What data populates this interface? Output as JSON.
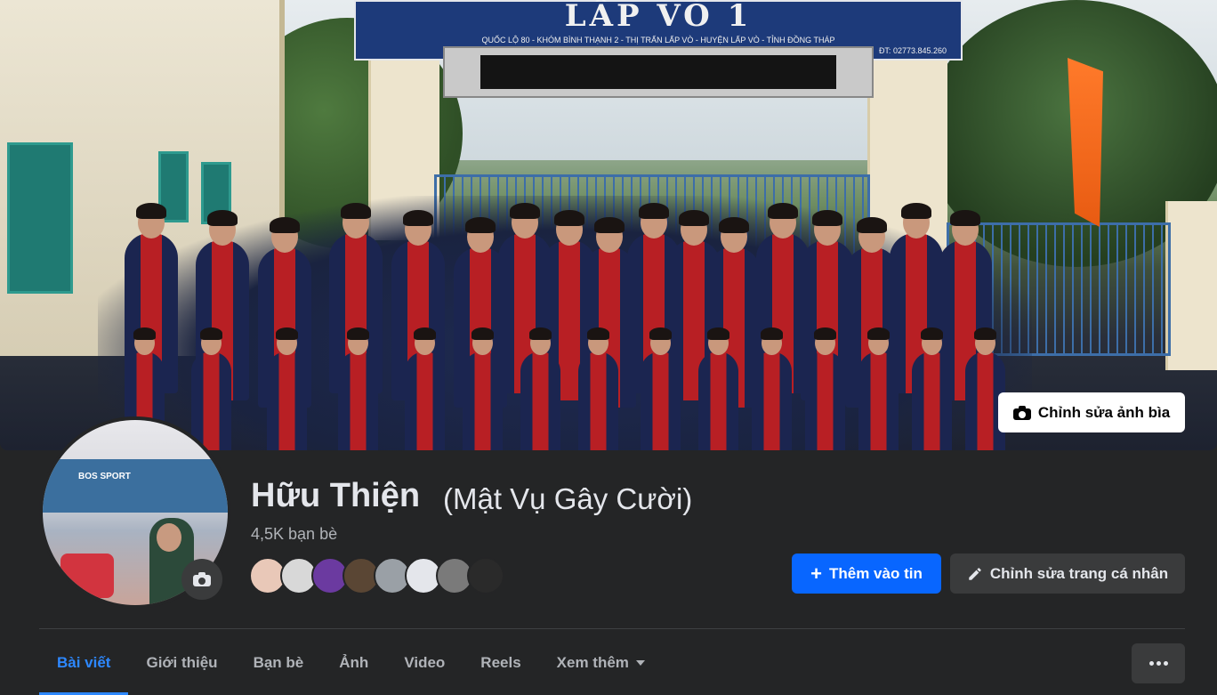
{
  "cover": {
    "school_sign_title": "LẤP VÒ 1",
    "school_sign_address": "QUỐC LỘ 80 - KHÓM BÌNH THẠNH 2 - THỊ TRẤN LẤP VÒ - HUYỆN LẤP VÒ - TỈNH ĐỒNG THÁP",
    "school_sign_phone": "ĐT: 02773.845.260",
    "edit_cover_label": "Chỉnh sửa ảnh bìa",
    "edit_cover_icon": "camera-icon"
  },
  "profile": {
    "name": "Hữu Thiện",
    "alternate_name": "(Mật Vụ Gây Cười)",
    "friends_count": "4,5K bạn bè",
    "avatar_camera_icon": "camera-icon",
    "friend_avatars": [
      {
        "bg": "#e9c8b8"
      },
      {
        "bg": "#d8d8d8"
      },
      {
        "bg": "#6b3aa0"
      },
      {
        "bg": "#5a4634"
      },
      {
        "bg": "#9aa0a6"
      },
      {
        "bg": "#e4e6eb"
      },
      {
        "bg": "#7a7a7a"
      },
      {
        "bg": "#2a2a2a"
      }
    ]
  },
  "actions": {
    "add_story_label": "Thêm vào tin",
    "edit_profile_label": "Chỉnh sửa trang cá nhân"
  },
  "tabs": [
    {
      "label": "Bài viết",
      "active": true
    },
    {
      "label": "Giới thiệu",
      "active": false
    },
    {
      "label": "Bạn bè",
      "active": false
    },
    {
      "label": "Ảnh",
      "active": false
    },
    {
      "label": "Video",
      "active": false
    },
    {
      "label": "Reels",
      "active": false
    },
    {
      "label": "Xem thêm",
      "active": false
    }
  ],
  "colors": {
    "background": "#242526",
    "primary_button": "#0866ff",
    "active_tab": "#2d88ff",
    "secondary_button": "#3a3b3c"
  }
}
